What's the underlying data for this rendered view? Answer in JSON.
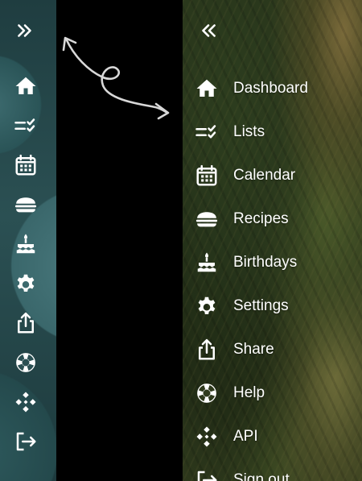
{
  "colors": {
    "icon": "#ffffff",
    "collapsed_sidebar_bg": "#2b5053",
    "gap_bg": "#000000",
    "arrow": "#d8d8d8"
  },
  "collapsed_sidebar": {
    "toggle_icon": "chevrons-right-icon",
    "items": [
      {
        "icon": "home-icon"
      },
      {
        "icon": "checklist-icon"
      },
      {
        "icon": "calendar-icon"
      },
      {
        "icon": "burger-icon"
      },
      {
        "icon": "cake-icon"
      },
      {
        "icon": "gear-icon"
      },
      {
        "icon": "share-icon"
      },
      {
        "icon": "lifebuoy-icon"
      },
      {
        "icon": "api-icon"
      },
      {
        "icon": "sign-out-icon"
      }
    ]
  },
  "expanded_sidebar": {
    "toggle_icon": "chevrons-left-icon",
    "items": [
      {
        "label": "Dashboard",
        "icon": "home-icon"
      },
      {
        "label": "Lists",
        "icon": "checklist-icon"
      },
      {
        "label": "Calendar",
        "icon": "calendar-icon"
      },
      {
        "label": "Recipes",
        "icon": "burger-icon"
      },
      {
        "label": "Birthdays",
        "icon": "cake-icon"
      },
      {
        "label": "Settings",
        "icon": "gear-icon"
      },
      {
        "label": "Share",
        "icon": "share-icon"
      },
      {
        "label": "Help",
        "icon": "lifebuoy-icon"
      },
      {
        "label": "API",
        "icon": "api-icon"
      },
      {
        "label": "Sign out",
        "icon": "sign-out-icon"
      }
    ]
  }
}
